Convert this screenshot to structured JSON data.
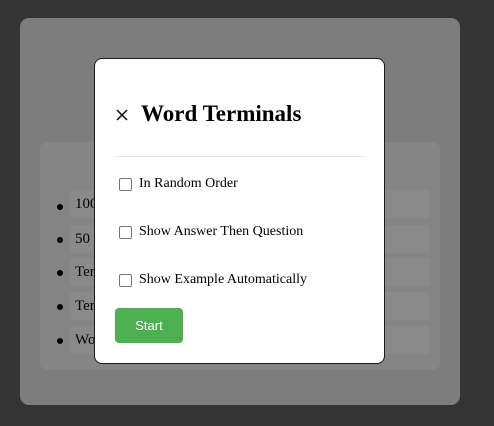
{
  "background": {
    "list_items": [
      {
        "label": "100"
      },
      {
        "label": "50"
      },
      {
        "label": "Ter"
      },
      {
        "label": "Ter"
      },
      {
        "label": "Wo"
      }
    ]
  },
  "modal": {
    "title": "Word Terminals",
    "close_icon": "close-icon",
    "options": [
      {
        "label": "In Random Order",
        "checked": false
      },
      {
        "label": "Show Answer Then Question",
        "checked": false
      },
      {
        "label": "Show Example Automatically",
        "checked": false
      }
    ],
    "start_label": "Start"
  },
  "colors": {
    "page_bg": "#343434",
    "overlay_panel": "#7d7d7d",
    "start_button": "#4caf50"
  }
}
